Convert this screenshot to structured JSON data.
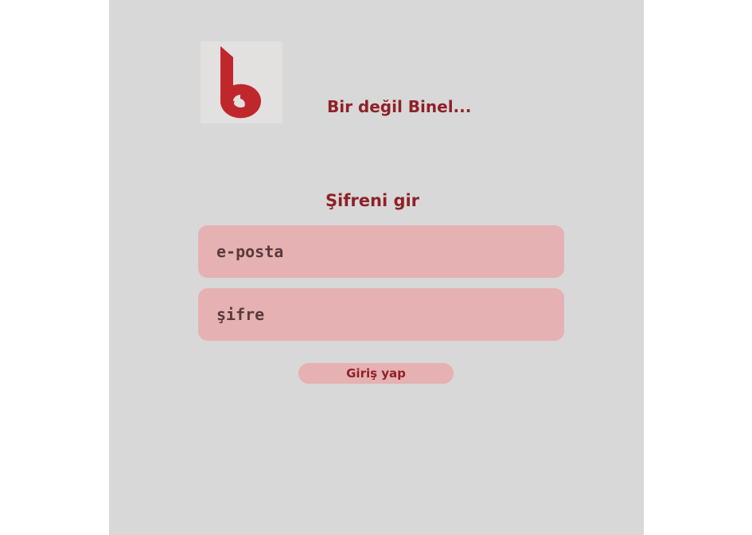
{
  "brand": {
    "logo_icon": "brand-b-logo",
    "tagline": "Bir değil Binel..."
  },
  "form": {
    "title": "Şifreni gir",
    "email_placeholder": "e-posta",
    "email_value": "",
    "password_placeholder": "şifre",
    "password_value": "",
    "submit_label": "Giriş yap"
  },
  "colors": {
    "background": "#d8d8d8",
    "accent": "#8f2128",
    "field_fill": "#e5b1b2",
    "logo": "#c0272d"
  }
}
